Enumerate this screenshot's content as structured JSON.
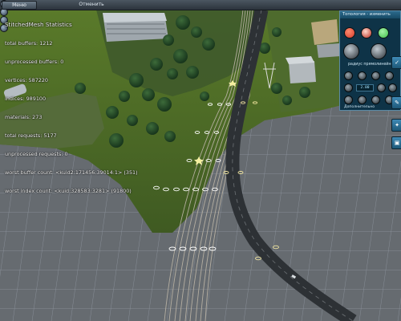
{
  "toolbar": {
    "menu_label": "Меню",
    "mode_label": "Отменить"
  },
  "stats": {
    "title": "StitchedMesh Statistics",
    "lines": [
      "total buffers: 1212",
      "unprocessed buffers: 0",
      "vertices: 587220",
      "indices: 989100",
      "materials: 273",
      "total requests: 5177",
      "unprocessed requests: 0",
      "worst buffer count: <kuid2:171456:39014:1> (351)",
      "worst index count: <kuid:328583:3281> (91800)"
    ]
  },
  "panel": {
    "title": "Топология - изменить",
    "radius_label": "радиус прямолинейности",
    "field_value": "2.00",
    "footer_label": "Дополнительно",
    "colors": {
      "red": "#d23b2b",
      "green": "#3fbf4a",
      "panel_bg": "#0e3347"
    }
  },
  "icons": [
    "gear-icon",
    "arrow-icon",
    "close-icon",
    "lock-icon",
    "track-icon"
  ]
}
